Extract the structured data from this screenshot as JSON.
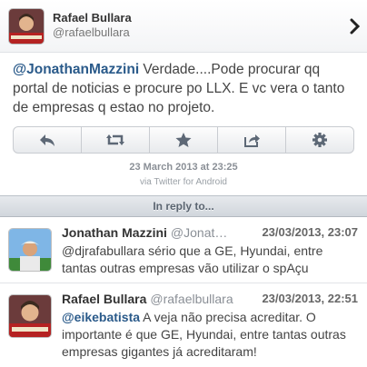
{
  "tweet": {
    "author_name": "Rafael Bullara",
    "author_handle": "@rafaelbullara",
    "mention": "@JonathanMazzini",
    "text": " Verdade....Pode procurar qq portal de noticias e procure po LLX. E vc vera o tanto de empresas q estao no projeto.",
    "date": "23 March 2013 at 23:25",
    "source": "via Twitter for Android"
  },
  "actions": [
    {
      "icon": "reply-icon"
    },
    {
      "icon": "retweet-icon"
    },
    {
      "icon": "favorite-star-icon"
    },
    {
      "icon": "share-icon"
    },
    {
      "icon": "settings-gear-icon"
    }
  ],
  "in_reply_to_label": "In reply to...",
  "replies": [
    {
      "name": "Jonathan Mazzini",
      "handle": "@Jonat…",
      "time": "23/03/2013, 23:07",
      "mention": "",
      "text": "@djrafabullara sério que a  GE, Hyundai, entre tantas outras empresas vão utilizar o spAçu"
    },
    {
      "name": "Rafael Bullara",
      "handle": "@rafaelbullara",
      "time": "23/03/2013, 22:51",
      "mention": "@eikebatista",
      "text": " A veja não precisa acreditar. O importante é que GE, Hyundai, entre tantas outras empresas gigantes já acreditaram!"
    }
  ],
  "colors": {
    "mention": "#2a5a8a",
    "reply_bar": "#d1d6dc"
  }
}
